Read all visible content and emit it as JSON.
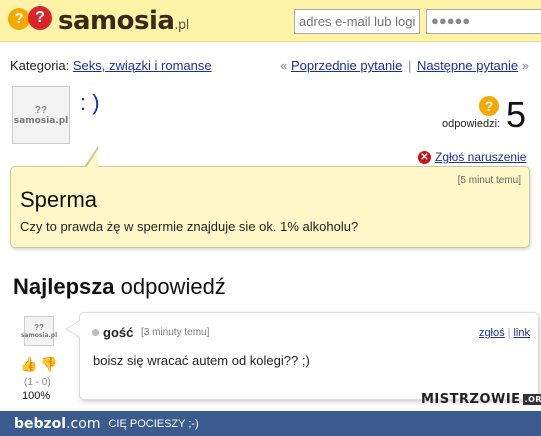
{
  "header": {
    "logo_mark": "?",
    "logo_name": "samosia",
    "logo_tld": ".pl",
    "login_email_placeholder": "adres e-mail lub login",
    "login_password_mask": "●●●●●"
  },
  "category": {
    "label": "Kategoria:",
    "value": "Seks, związki i romanse"
  },
  "nav": {
    "prev_arrow": "«",
    "prev": "Poprzednie pytanie",
    "separator": "|",
    "next": "Następne pytanie",
    "next_arrow": "»"
  },
  "asker": {
    "avatar_text": "samosia.pl",
    "name": ": )"
  },
  "answers": {
    "label": "odpowiedzi:",
    "count": "5"
  },
  "report": {
    "label": "Zgłoś naruszenie"
  },
  "question": {
    "time": "[5 minut temu]",
    "title": "Sperma",
    "body": "Czy to prawda żę w spermie znajduje sie ok. 1% alkoholu?"
  },
  "best_answer": {
    "heading_bold": "Najlepsza",
    "heading_rest": " odpowiedź"
  },
  "answer": {
    "avatar_text": "samosia.pl",
    "user": "gość",
    "time": "[3 minuty temu]",
    "report_link": "zgłoś",
    "link_sep": "|",
    "link": "link",
    "text": "boisz się wracać autem od kolegi?? ;)",
    "votes": "(1 - 0)",
    "percent": "100%"
  },
  "watermark": {
    "name": "MISTRZOWIE",
    "tld": ".ORG"
  },
  "footer": {
    "brand": "bebzol",
    "brand_tld": ".com",
    "slogan": "CIĘ POCIESZY ;-)"
  }
}
